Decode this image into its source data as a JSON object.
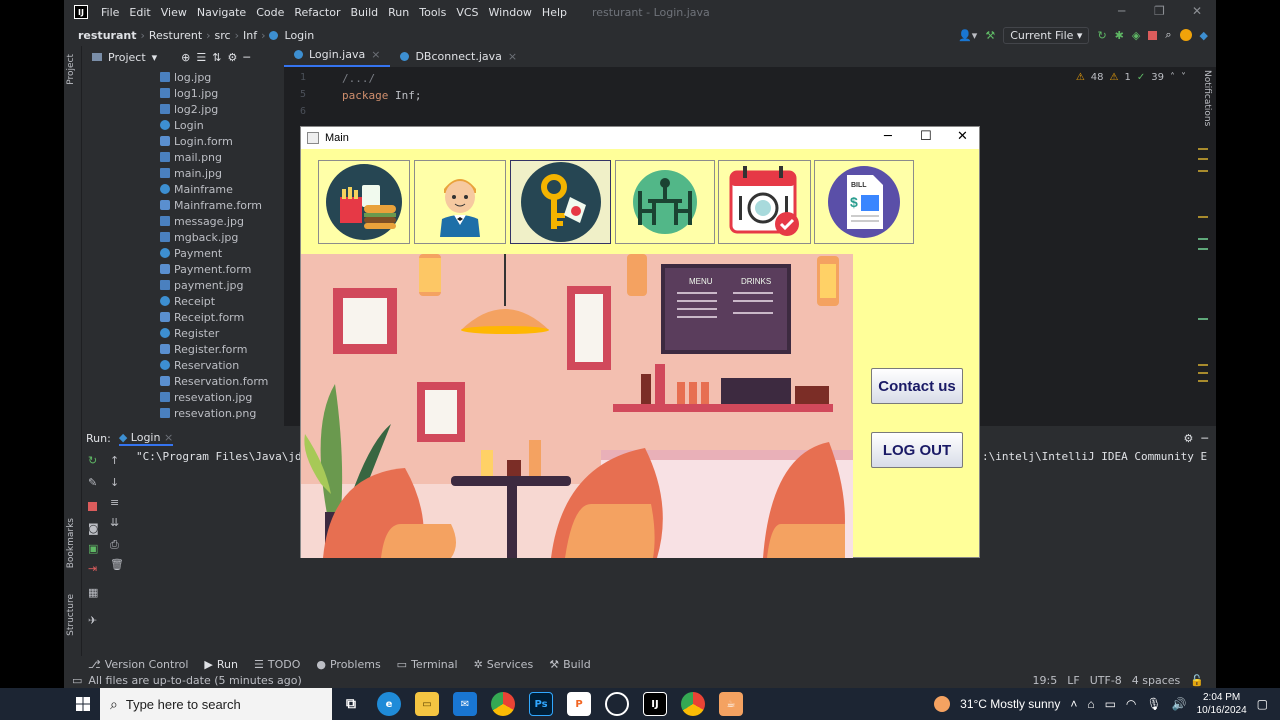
{
  "menu": [
    "File",
    "Edit",
    "View",
    "Navigate",
    "Code",
    "Refactor",
    "Build",
    "Run",
    "Tools",
    "VCS",
    "Window",
    "Help"
  ],
  "window_title": "resturant - Login.java",
  "breadcrumbs": [
    "resturant",
    "Resturent",
    "src",
    "Inf",
    "Login"
  ],
  "run_config": "Current File",
  "project": {
    "label": "Project",
    "items": [
      "log.jpg",
      "log1.jpg",
      "log2.jpg",
      "Login",
      "Login.form",
      "mail.png",
      "main.jpg",
      "Mainframe",
      "Mainframe.form",
      "message.jpg",
      "mgback.jpg",
      "Payment",
      "Payment.form",
      "payment.jpg",
      "Receipt",
      "Receipt.form",
      "Register",
      "Register.form",
      "Reservation",
      "Reservation.form",
      "resevation.jpg",
      "resevation.png"
    ]
  },
  "editor": {
    "tabs": [
      "Login.java",
      "DBconnect.java"
    ],
    "line_numbers": [
      "1",
      "5",
      "6"
    ],
    "fold_text": "/.../",
    "keyword": "package",
    "package_name": "Inf;",
    "inspections": {
      "warnings": "48",
      "weak": "1",
      "typos": "39"
    }
  },
  "run": {
    "label": "Run:",
    "tab": "Login",
    "output_left": "\"C:\\Program Files\\Java\\jdk",
    "output_right": ":\\intelj\\IntelliJ IDEA Community E"
  },
  "side_labels": {
    "project": "Project",
    "bookmarks": "Bookmarks",
    "structure": "Structure",
    "notifications": "Notifications"
  },
  "bottom_tools": [
    "Version Control",
    "Run",
    "TODO",
    "Problems",
    "Terminal",
    "Services",
    "Build"
  ],
  "status": {
    "message": "All files are up-to-date (5 minutes ago)",
    "position": "19:5",
    "line_sep": "LF",
    "encoding": "UTF-8",
    "indent": "4 spaces"
  },
  "swing": {
    "title": "Main",
    "contact_label": "Contact us",
    "logout_label": "LOG OUT",
    "menu_card": {
      "menu": "MENU",
      "drinks": "DRINKS"
    },
    "bill_text": "BILL",
    "bill_symbol": "$"
  },
  "taskbar": {
    "search_placeholder": "Type here to search",
    "weather": "31°C  Mostly sunny",
    "time": "2:04 PM",
    "date": "10/16/2024"
  }
}
